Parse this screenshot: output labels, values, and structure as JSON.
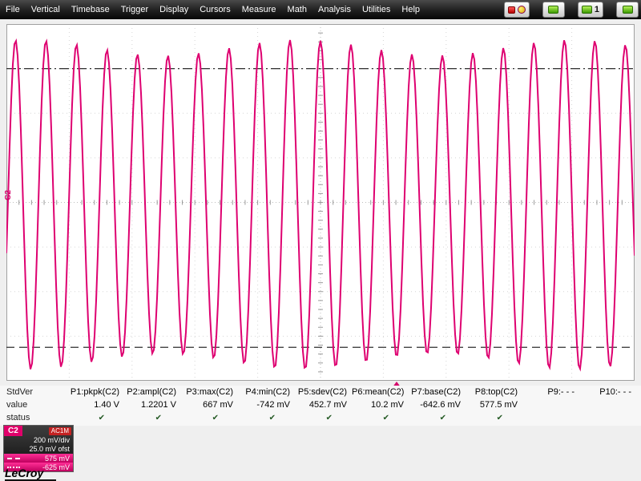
{
  "menu": {
    "items": [
      "File",
      "Vertical",
      "Timebase",
      "Trigger",
      "Display",
      "Cursors",
      "Measure",
      "Math",
      "Analysis",
      "Utilities",
      "Help"
    ]
  },
  "toolbar": {
    "counter": "1"
  },
  "scope": {
    "channel_trace_label": "C2",
    "grid": {
      "xdivs": 10,
      "ydivs": 8
    },
    "cursors": {
      "top_div": 3.0,
      "bottom_div": -3.25
    },
    "waveform": {
      "color": "#de0070",
      "cycles": 20.6,
      "amplitude_div": 3.52,
      "center_div_offset": -0.05,
      "phase": -0.3,
      "modulation": 0.05
    }
  },
  "measurements": {
    "row_headers": {
      "top": "StdVer",
      "middle": "value",
      "bottom": "status"
    },
    "status_ok_glyph": "✔",
    "columns": [
      {
        "label": "P1:pkpk(C2)",
        "value": "1.40 V",
        "ok": true
      },
      {
        "label": "P2:ampl(C2)",
        "value": "1.2201 V",
        "ok": true
      },
      {
        "label": "P3:max(C2)",
        "value": "667 mV",
        "ok": true
      },
      {
        "label": "P4:min(C2)",
        "value": "-742 mV",
        "ok": true
      },
      {
        "label": "P5:sdev(C2)",
        "value": "452.7 mV",
        "ok": true
      },
      {
        "label": "P6:mean(C2)",
        "value": "10.2 mV",
        "ok": true
      },
      {
        "label": "P7:base(C2)",
        "value": "-642.6 mV",
        "ok": true
      },
      {
        "label": "P8:top(C2)",
        "value": "577.5 mV",
        "ok": true
      },
      {
        "label": "P9:- - -",
        "value": "",
        "ok": false
      },
      {
        "label": "P10:- - -",
        "value": "",
        "ok": false
      }
    ]
  },
  "channel_box": {
    "channel": "C2",
    "coupling_badge": "AC1M",
    "scale": "200 mV/div",
    "offset": "25.0 mV ofst",
    "cursor_top": "575 mV",
    "cursor_bottom": "-625 mV"
  },
  "logo": "LeCroy"
}
